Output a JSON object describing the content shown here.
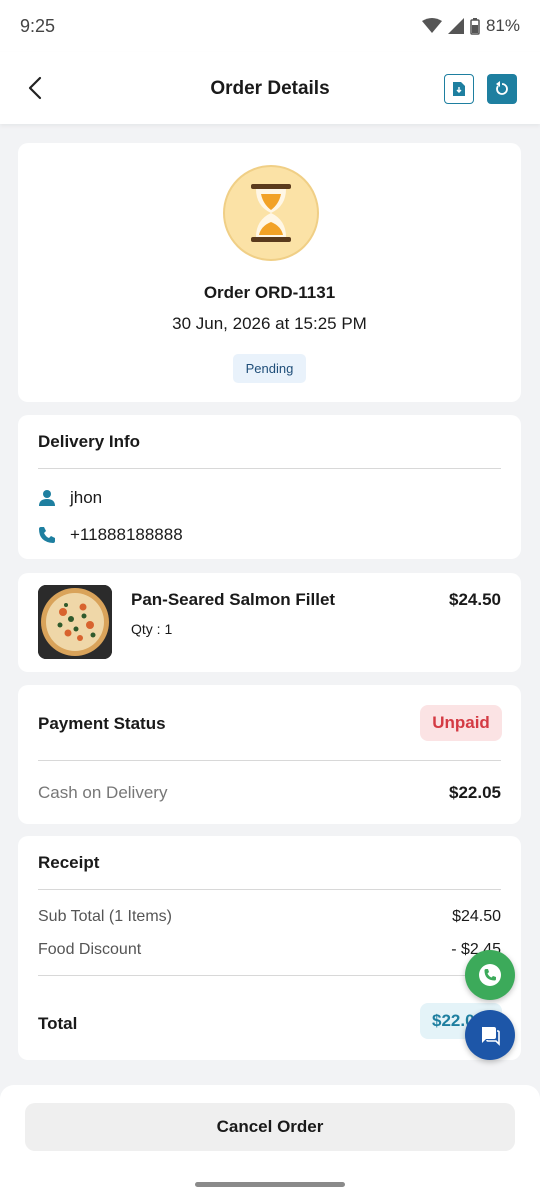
{
  "status_bar": {
    "time": "9:25",
    "battery": "81%"
  },
  "header": {
    "title": "Order Details"
  },
  "order": {
    "number": "Order ORD-1131",
    "datetime": "30 Jun, 2026 at 15:25 PM",
    "status": "Pending"
  },
  "delivery": {
    "title": "Delivery Info",
    "name": "jhon",
    "phone": "+11888188888"
  },
  "item": {
    "name": "Pan-Seared Salmon Fillet",
    "qty": "Qty : 1",
    "price": "$24.50"
  },
  "payment": {
    "title": "Payment Status",
    "status": "Unpaid",
    "method": "Cash on Delivery",
    "amount": "$22.05"
  },
  "receipt": {
    "title": "Receipt",
    "subtotal_label": "Sub Total (1 Items)",
    "subtotal_value": "$24.50",
    "discount_label": "Food Discount",
    "discount_value": "- $2.45",
    "total_label": "Total",
    "total_value": "$22.05"
  },
  "footer": {
    "cancel_label": "Cancel Order"
  },
  "colors": {
    "accent": "#1e7fa0",
    "unpaid": "#d43b44",
    "call": "#3caa5a",
    "chat": "#1d56a8"
  }
}
